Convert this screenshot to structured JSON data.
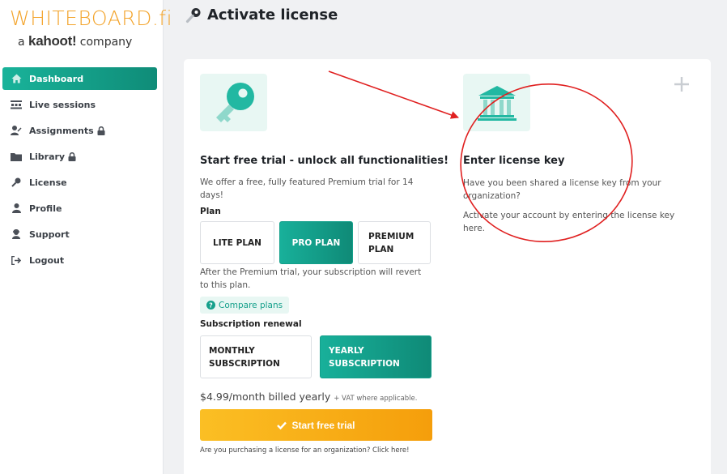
{
  "brand": {
    "logo_text": "WHITEBOARD.fi",
    "sub_prefix": "a",
    "sub_brand": "kahoot!",
    "sub_suffix": "company"
  },
  "sidebar": {
    "items": [
      {
        "label": "Dashboard",
        "icon": "home-icon",
        "active": true,
        "locked": false
      },
      {
        "label": "Live sessions",
        "icon": "sessions-icon",
        "active": false,
        "locked": false
      },
      {
        "label": "Assignments",
        "icon": "assignments-icon",
        "active": false,
        "locked": true
      },
      {
        "label": "Library",
        "icon": "folder-icon",
        "active": false,
        "locked": true
      },
      {
        "label": "License",
        "icon": "key-icon",
        "active": false,
        "locked": false
      },
      {
        "label": "Profile",
        "icon": "user-icon",
        "active": false,
        "locked": false
      },
      {
        "label": "Support",
        "icon": "support-icon",
        "active": false,
        "locked": false
      },
      {
        "label": "Logout",
        "icon": "logout-icon",
        "active": false,
        "locked": false
      }
    ]
  },
  "header": {
    "title": "Activate license",
    "icon": "key-icon"
  },
  "trial": {
    "title": "Start free trial - unlock all functionalities!",
    "description": "We offer a free, fully featured Premium trial for 14 days!",
    "plan_label": "Plan",
    "plans": [
      {
        "label": "LITE PLAN",
        "selected": false
      },
      {
        "label": "PRO PLAN",
        "selected": true
      },
      {
        "label": "PREMIUM PLAN",
        "selected": false
      }
    ],
    "note": "After the Premium trial, your subscription will revert to this plan.",
    "compare_label": "Compare plans",
    "renewal_label": "Subscription renewal",
    "subscriptions": [
      {
        "label": "MONTHLY SUBSCRIPTION",
        "selected": false
      },
      {
        "label": "YEARLY SUBSCRIPTION",
        "selected": true
      }
    ],
    "price": "$4.99/month billed yearly",
    "vat": "+ VAT where applicable.",
    "cta_label": "Start free trial",
    "org_link": "Are you purchasing a license for an organization? Click here!"
  },
  "license_key": {
    "title": "Enter license key",
    "description": "Have you been shared a license key from your organization?",
    "description2": "Activate your account by entering the license key here."
  },
  "colors": {
    "teal": "#15a08b",
    "accent_yellow": "#f59e0b",
    "annotation_red": "#e02020",
    "logo_orange": "#f3a42c"
  }
}
